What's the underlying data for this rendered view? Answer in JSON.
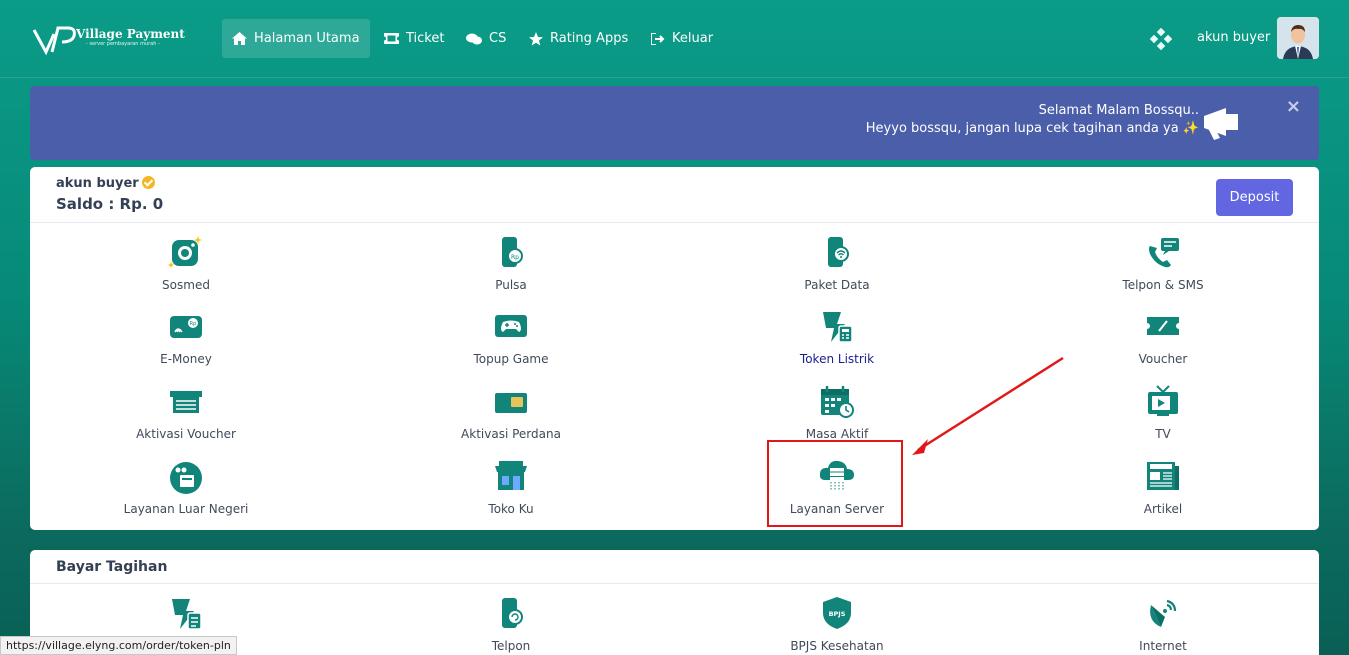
{
  "brand": {
    "name": "Village Payment",
    "tagline": "- server pembayaran murah -"
  },
  "nav": {
    "items": [
      {
        "label": "Halaman Utama",
        "icon": "home-icon",
        "active": true
      },
      {
        "label": "Ticket",
        "icon": "ticket-icon"
      },
      {
        "label": "CS",
        "icon": "chat-icon"
      },
      {
        "label": "Rating Apps",
        "icon": "star-icon"
      },
      {
        "label": "Keluar",
        "icon": "logout-icon"
      }
    ],
    "user_name": "akun buyer"
  },
  "alert": {
    "title": "Selamat Malam Bossqu..",
    "message": "Heyyo bossqu, jangan lupa cek tagihan anda ya ✨",
    "close": "×"
  },
  "account": {
    "name": "akun buyer",
    "saldo": "Saldo : Rp. 0",
    "deposit_label": "Deposit"
  },
  "services": [
    {
      "label": "Sosmed",
      "icon": "camera-icon"
    },
    {
      "label": "Pulsa",
      "icon": "phone-rp-icon"
    },
    {
      "label": "Paket Data",
      "icon": "phone-wifi-icon"
    },
    {
      "label": "Telpon & SMS",
      "icon": "phone-chat-icon"
    },
    {
      "label": "E-Money",
      "icon": "wallet-icon"
    },
    {
      "label": "Topup Game",
      "icon": "gamepad-icon"
    },
    {
      "label": "Token Listrik",
      "icon": "bolt-icon"
    },
    {
      "label": "Voucher",
      "icon": "voucher-icon"
    },
    {
      "label": "Aktivasi Voucher",
      "icon": "card-icon"
    },
    {
      "label": "Aktivasi Perdana",
      "icon": "sim-icon"
    },
    {
      "label": "Masa Aktif",
      "icon": "calendar-icon"
    },
    {
      "label": "TV",
      "icon": "tv-icon"
    },
    {
      "label": "Layanan Luar Negeri",
      "icon": "globe-icon"
    },
    {
      "label": "Toko Ku",
      "icon": "store-icon"
    },
    {
      "label": "Layanan Server",
      "icon": "cloud-server-icon"
    },
    {
      "label": "Artikel",
      "icon": "news-icon"
    }
  ],
  "bills": {
    "title": "Bayar Tagihan",
    "items": [
      {
        "label": "",
        "icon": "bolt-bill-icon"
      },
      {
        "label": "Telpon",
        "icon": "phone-refresh-icon"
      },
      {
        "label": "BPJS Kesehatan",
        "icon": "bpjs-shield-icon",
        "badge": "BPJS"
      },
      {
        "label": "Internet",
        "icon": "satellite-icon"
      }
    ]
  },
  "status_url": "https://village.elyng.com/order/token-pln",
  "colors": {
    "teal": "#0a9c88",
    "icon": "#11857a",
    "alert": "#4b5eaa",
    "deposit": "#6366e1",
    "highlight": "#e01818"
  }
}
